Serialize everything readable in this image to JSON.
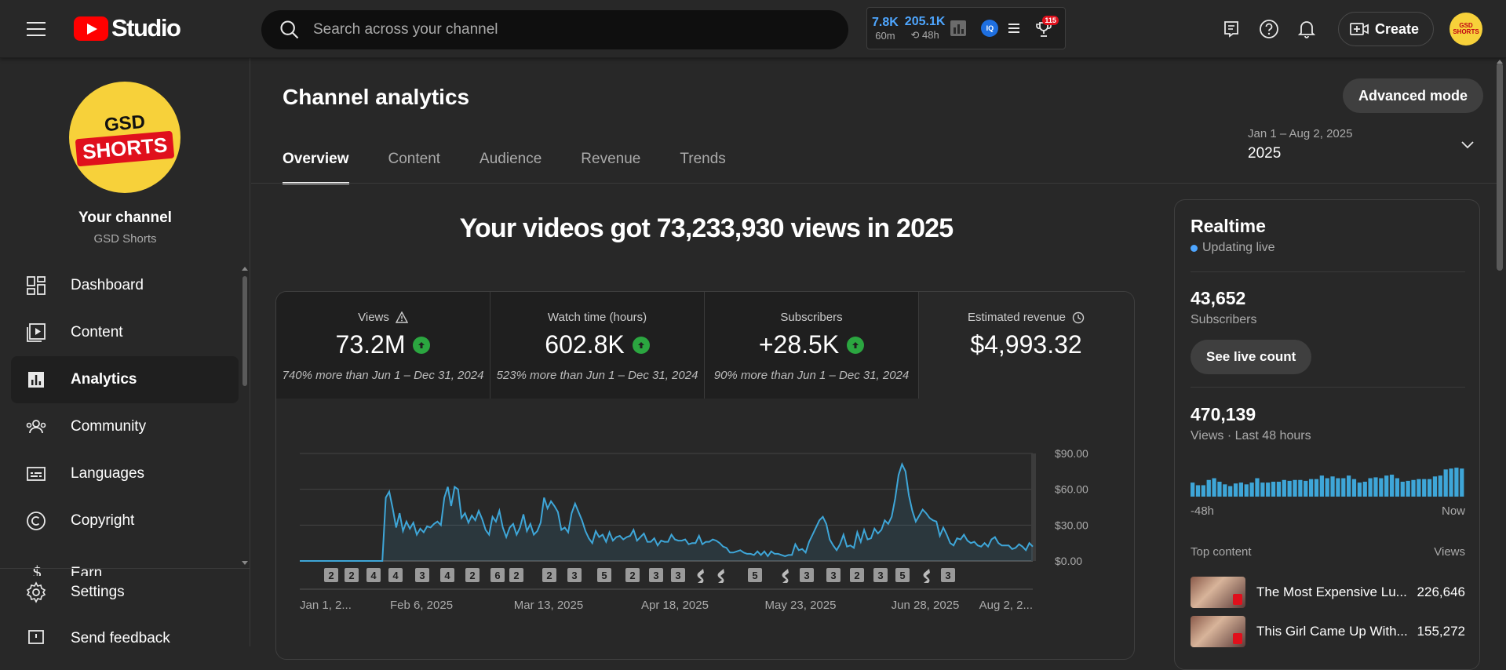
{
  "header": {
    "logo_text": "Studio",
    "search_placeholder": "Search across your channel",
    "ext": {
      "stat1_big": "7.8K",
      "stat1_small": "60m",
      "stat2_big": "205.1K",
      "stat2_small": "48h",
      "iq": "IQ",
      "trophy_badge": "115"
    },
    "create_label": "Create",
    "avatar_text": "GSD SHORTS"
  },
  "sidebar": {
    "avatar_top": "GSD",
    "avatar_bottom": "SHORTS",
    "your_channel": "Your channel",
    "channel_name": "GSD Shorts",
    "items": [
      {
        "label": "Dashboard",
        "icon": "dashboard-icon"
      },
      {
        "label": "Content",
        "icon": "content-icon"
      },
      {
        "label": "Analytics",
        "icon": "analytics-icon"
      },
      {
        "label": "Community",
        "icon": "community-icon"
      },
      {
        "label": "Languages",
        "icon": "languages-icon"
      },
      {
        "label": "Copyright",
        "icon": "copyright-icon"
      },
      {
        "label": "Earn",
        "icon": "earn-icon"
      }
    ],
    "settings": "Settings",
    "feedback": "Send feedback"
  },
  "main": {
    "title": "Channel analytics",
    "advanced_mode": "Advanced mode",
    "tabs": [
      "Overview",
      "Content",
      "Audience",
      "Revenue",
      "Trends"
    ],
    "date_range": "Jan 1 – Aug 2, 2025",
    "date_label": "2025",
    "headline": "Your videos got 73,233,930 views in 2025",
    "metrics": [
      {
        "label": "Views",
        "value": "73.2M",
        "compare": "740% more than Jun 1 – Dec 31, 2024"
      },
      {
        "label": "Watch time (hours)",
        "value": "602.8K",
        "compare": "523% more than Jun 1 – Dec 31, 2024"
      },
      {
        "label": "Subscribers",
        "value": "+28.5K",
        "compare": "90% more than Jun 1 – Dec 31, 2024"
      },
      {
        "label": "Estimated revenue",
        "value": "$4,993.32"
      }
    ]
  },
  "chart_data": {
    "type": "area",
    "title": "",
    "xlabel": "",
    "ylabel": "",
    "x_ticks": [
      "Jan 1, 2...",
      "Feb 6, 2025",
      "Mar 13, 2025",
      "Apr 18, 2025",
      "May 23, 2025",
      "Jun 28, 2025",
      "Aug 2, 2..."
    ],
    "y_ticks": [
      "$0.00",
      "$30.00",
      "$60.00",
      "$90.00"
    ],
    "ylim": [
      0,
      90
    ],
    "y_axis_side": "right",
    "series": [
      {
        "color": "#3ea6d8",
        "values": [
          0,
          0,
          0,
          0,
          0,
          0,
          0,
          0,
          0,
          0,
          0,
          0,
          0,
          0,
          0,
          0,
          0,
          0,
          0,
          0,
          0,
          0,
          0,
          0,
          0,
          53,
          58,
          44,
          28,
          40,
          25,
          33,
          27,
          32,
          22,
          27,
          24,
          29,
          28,
          31,
          33,
          30,
          53,
          62,
          46,
          62,
          60,
          36,
          40,
          32,
          38,
          34,
          42,
          35,
          26,
          22,
          37,
          33,
          42,
          28,
          20,
          28,
          31,
          22,
          28,
          39,
          25,
          31,
          22,
          25,
          32,
          53,
          44,
          50,
          46,
          41,
          26,
          28,
          24,
          40,
          48,
          41,
          34,
          25,
          19,
          15,
          25,
          20,
          22,
          16,
          24,
          17,
          20,
          21,
          18,
          20,
          21,
          26,
          17,
          20,
          23,
          16,
          16,
          19,
          13,
          17,
          16,
          16,
          22,
          18,
          17,
          17,
          18,
          14,
          15,
          15,
          21,
          14,
          16,
          16,
          18,
          17,
          15,
          12,
          11,
          7,
          7,
          8,
          9,
          7,
          6,
          6,
          5,
          8,
          5,
          8,
          4,
          8,
          6,
          6,
          5,
          4,
          5,
          5,
          14,
          9,
          10,
          7,
          16,
          22,
          28,
          34,
          37,
          31,
          18,
          13,
          9,
          14,
          22,
          12,
          13,
          11,
          24,
          16,
          26,
          18,
          19,
          27,
          23,
          26,
          34,
          31,
          37,
          52,
          72,
          81,
          75,
          55,
          42,
          33,
          38,
          43,
          40,
          36,
          34,
          33,
          21,
          28,
          22,
          15,
          13,
          19,
          18,
          22,
          17,
          15,
          16,
          13,
          12,
          15,
          12,
          18,
          20,
          15,
          13,
          13,
          13,
          10,
          11,
          14,
          12,
          9,
          15,
          12
        ]
      }
    ],
    "video_markers": [
      "2",
      "2",
      "4",
      "4",
      "3",
      "4",
      "2",
      "6",
      "2",
      "2",
      "3",
      "5",
      "2",
      "3",
      "3",
      "S",
      "S",
      "5",
      "S",
      "3",
      "3",
      "2",
      "3",
      "5",
      "S",
      "3"
    ]
  },
  "realtime": {
    "title": "Realtime",
    "live_label": "Updating live",
    "subs_value": "43,652",
    "subs_label": "Subscribers",
    "live_count_btn": "See live count",
    "views_value": "470,139",
    "views_label": "Views · Last 48 hours",
    "bars": [
      16,
      13,
      13,
      19,
      21,
      17,
      14,
      12,
      15,
      16,
      14,
      16,
      21,
      16,
      16,
      17,
      17,
      19,
      18,
      19,
      19,
      18,
      20,
      20,
      24,
      21,
      23,
      21,
      21,
      24,
      20,
      16,
      17,
      21,
      22,
      21,
      24,
      25,
      21,
      17,
      18,
      19,
      20,
      20,
      20,
      23,
      24,
      31,
      32,
      33,
      32
    ],
    "bar_start": "-48h",
    "bar_end": "Now",
    "top_content_label": "Top content",
    "views_col": "Views",
    "top_items": [
      {
        "title": "The Most Expensive Lu...",
        "views": "226,646"
      },
      {
        "title": "This Girl Came Up With...",
        "views": "155,272"
      }
    ]
  }
}
